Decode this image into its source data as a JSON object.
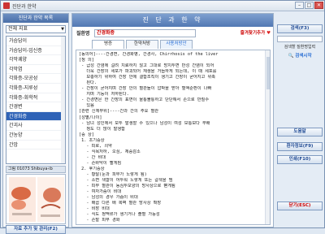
{
  "window": {
    "title": "진단과 한약"
  },
  "left": {
    "header": "진단과 한약 목록",
    "filter_value": "전체 지표",
    "items": [
      "가슴답이",
      "가슴답이-임신증",
      "각막궤양",
      "각막염",
      "각화증-모공성",
      "각화증-지루성",
      "각화증-화학적",
      "간경변",
      "간경화증",
      "간괴사",
      "간농양",
      "간암"
    ],
    "selected_index": 8,
    "book_caption": "그림   01073 Shibuya-ib",
    "add_button": "자료 추가 및 관리(F2)"
  },
  "main": {
    "header": "진 단 과 한 약",
    "name_label": "질환명",
    "name_value": "간경화증",
    "favorite_label": "즐겨찾기추가",
    "tabs": [
      "병증",
      "한약처방",
      "사용처방안"
    ],
    "lines": [
      "[동의어]----간경변, 간경화병, 간경사, Chirrhosis of the liver",
      "[정 의]",
      " - 급성 간염에 걸려 치료하지 않고 그대로 방치두면 만성 간염이 되어",
      "   더욱 간장의 세포가 파괴되어 재생을 거듭하게 되는데, 이 때 세포를",
      "   보충하기 위하여 간장 안에 결합조직이 생기고 간장이 굳어지고 위축",
      "   된다.",
      " - 간장이 굳어지며 간장 안의 혈관들이 압박을 받아 혈액순환이 나빠",
      "   지며 기능이 저하된다.",
      " - 간경변은 한 간장의 표면이 울퉁불퉁하고 단단해서 손으로 만질수",
      "   있음",
      "[관련 신체부위]----간과 간의 주요 혈관",
      "[성별/나이]",
      " - 남녀 성인에서 모두 발생할 수 있으나 남성이 여성 보통보다 무배",
      "   정도 더 많이 발생함",
      "[증 상]",
      " 1. 초기증상",
      "   - 피로, 쇠약",
      "   - 식욕저하, 오심, 체중감소",
      "   - 간 비대",
      "   - 손바닥이 빨게짐",
      " 2. 후기증상",
      "   - 황달(눈과 피부가 노랗게 됨)",
      "   - 소변 색깔이 어두워 노랗게 또는 갈색을 띰",
      "   - 피부 혈관이 동심두모양의 방사상으로 뻗게됨",
      "   - 여자가슴이 비대",
      "   - 남성의 경우 가슴이 비대",
      "   - 배꼽 다른 배 복벽 혈관 방사상 확장",
      "   - 비장 비대",
      "   - 식도 정맥류가 생기거나 출혈 가능성",
      "   - 손발 피부 경화"
    ]
  },
  "right": {
    "search_button": "검색(F3)",
    "search_input_value": "",
    "search_label": "검색할 질환명입력",
    "search_link": "검색시작",
    "help_button": "도움말",
    "info_button": "환자정보(F9)",
    "print_button": "인쇄(F10)",
    "close_button": "닫기(ESC)"
  }
}
